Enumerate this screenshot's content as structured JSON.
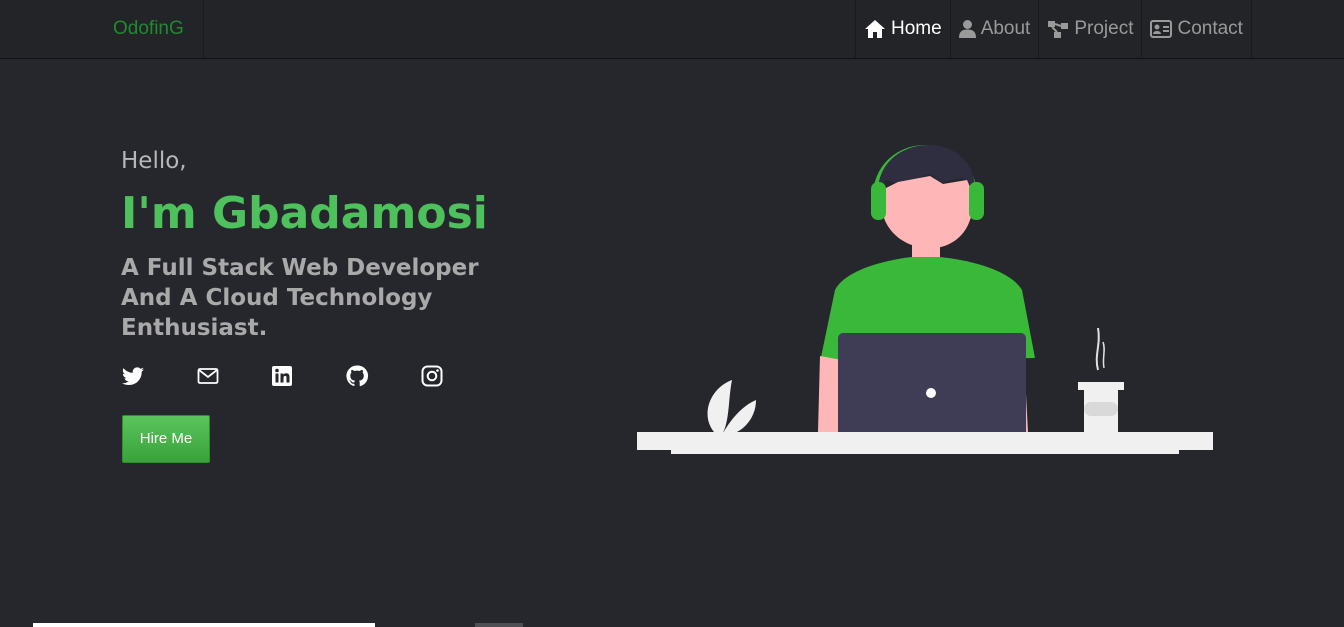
{
  "brand": "OdofinG",
  "nav": [
    {
      "label": "Home",
      "icon": "home-icon",
      "active": true
    },
    {
      "label": "About",
      "icon": "user-icon",
      "active": false
    },
    {
      "label": "Project",
      "icon": "project-icon",
      "active": false
    },
    {
      "label": "Contact",
      "icon": "contact-card-icon",
      "active": false
    }
  ],
  "hero": {
    "greeting": "Hello,",
    "name": "I'm Gbadamosi",
    "tagline": "A Full Stack Web Developer And A Cloud Technology Enthusiast.",
    "cta": "Hire Me"
  },
  "socials": [
    "twitter-icon",
    "mail-icon",
    "linkedin-icon",
    "github-icon",
    "instagram-icon"
  ],
  "colors": {
    "background": "#25272d",
    "navbar": "#222427",
    "accent": "#4ec15c",
    "brand": "#1f8a2e",
    "illustration_green": "#3ab83a"
  }
}
